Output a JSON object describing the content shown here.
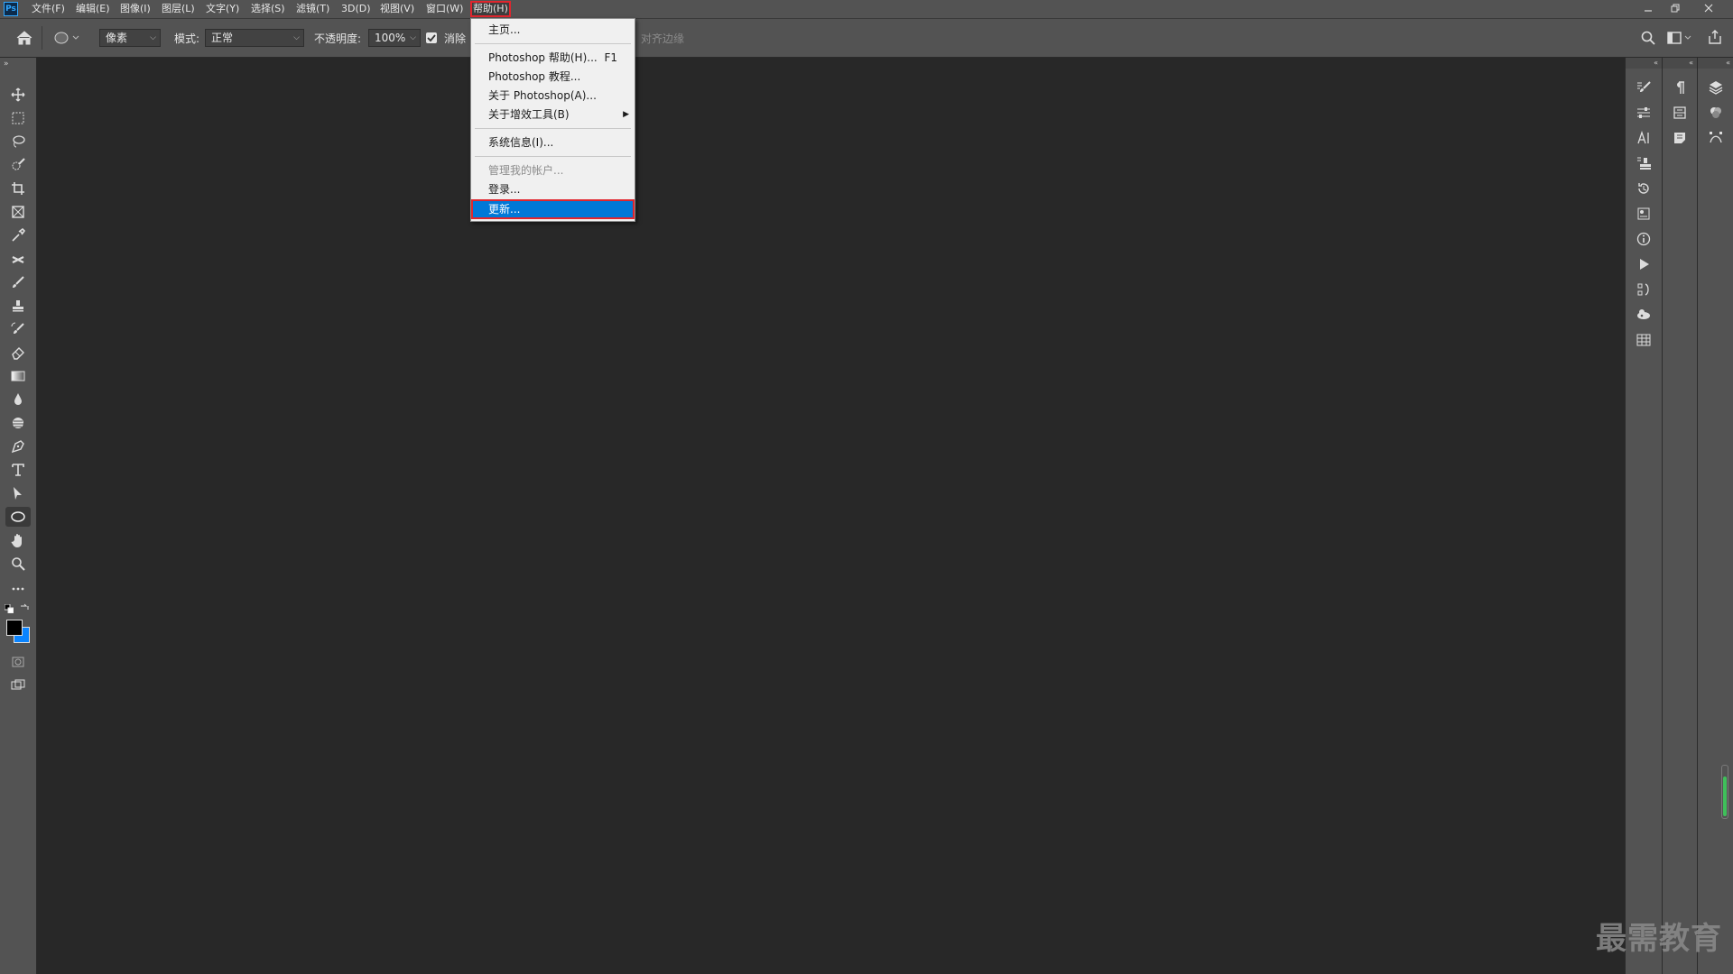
{
  "app": {
    "logo": "Ps",
    "colors": {
      "accent": "#0078d7",
      "highlight_outline": "#e0262e",
      "menu_bg": "#535353",
      "canvas_bg": "#282828"
    }
  },
  "menubar": {
    "items": [
      {
        "label": "文件(F)"
      },
      {
        "label": "编辑(E)"
      },
      {
        "label": "图像(I)"
      },
      {
        "label": "图层(L)"
      },
      {
        "label": "文字(Y)"
      },
      {
        "label": "选择(S)"
      },
      {
        "label": "滤镜(T)"
      },
      {
        "label": "3D(D)"
      },
      {
        "label": "视图(V)"
      },
      {
        "label": "窗口(W)"
      },
      {
        "label": "帮助(H)",
        "active": true
      }
    ],
    "window_buttons": [
      "minimize-icon",
      "restore-icon",
      "close-icon"
    ]
  },
  "options": {
    "tool_icon": "ellipse-icon",
    "pixel_mode": "像素",
    "mode_label": "模式:",
    "mode_value": "正常",
    "opacity_label": "不透明度:",
    "opacity_value": "100%",
    "antialias_label": "消除",
    "antialias_checked": true,
    "align_edges_label": "对齐边缘"
  },
  "help_menu": {
    "items": [
      {
        "label": "主页..."
      },
      {
        "label": "Photoshop 帮助(H)...",
        "shortcut": "F1"
      },
      {
        "label": "Photoshop 教程..."
      },
      {
        "label": "关于 Photoshop(A)..."
      },
      {
        "label": "关于增效工具(B)",
        "submenu": true
      },
      {
        "label": "系统信息(I)..."
      },
      {
        "label": "管理我的帐户...",
        "disabled": true
      },
      {
        "label": "登录..."
      },
      {
        "label": "更新...",
        "highlighted": true
      }
    ]
  },
  "toolbar": {
    "tools": [
      "move-icon",
      "marquee-icon",
      "lasso-icon",
      "quick-select-icon",
      "crop-icon",
      "frame-icon",
      "eyedropper-icon",
      "healing-icon",
      "brush-icon",
      "stamp-icon",
      "history-brush-icon",
      "eraser-icon",
      "gradient-icon",
      "blur-icon",
      "dodge-icon",
      "pen-icon",
      "type-icon",
      "path-select-icon",
      "ellipse-icon",
      "hand-icon",
      "zoom-icon",
      "more-icon"
    ],
    "selected": "ellipse-icon"
  },
  "watermark": "最需教育"
}
